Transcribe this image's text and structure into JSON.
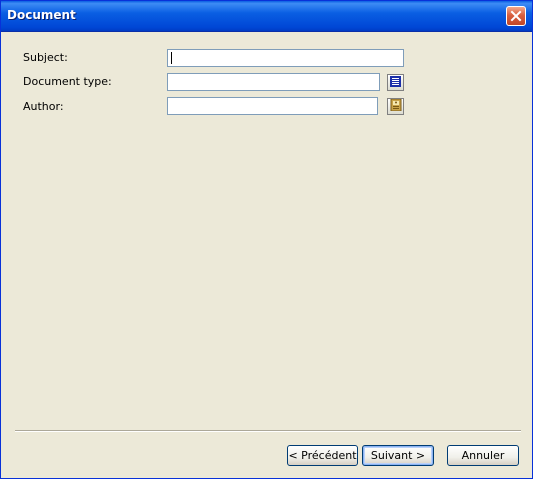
{
  "window": {
    "title": "Document",
    "close_icon": "close-icon"
  },
  "form": {
    "subject": {
      "label": "Subject:",
      "value": ""
    },
    "document_type": {
      "label": "Document type:",
      "value": "",
      "button_icon": "list-icon"
    },
    "author": {
      "label": "Author:",
      "value": "",
      "button_icon": "address-book-icon"
    }
  },
  "buttons": {
    "previous": "< Précédent",
    "next": "Suivant >",
    "cancel": "Annuler"
  },
  "colors": {
    "titlebar": "#0a5fe3",
    "dialog_bg": "#ece9d8",
    "close_button": "#d86040"
  }
}
